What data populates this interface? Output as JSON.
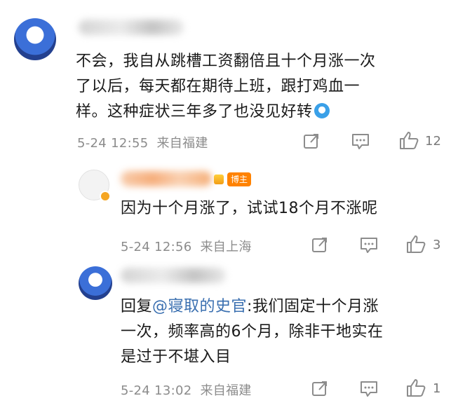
{
  "comments": [
    {
      "username": "",
      "text": "不会，我自从跳槽工资翻倍且十个月涨一次了以后，每天都在期待上班，跟打鸡血一样。这种症状三年多了也没见好转",
      "text_lines": [
        "不会，我自从跳槽工资翻倍且十个月涨一次",
        "了以后，每天都在期待上班，跟打鸡血一",
        "样。这种症状三年多了也没见好转"
      ],
      "emoji": "crying-laughing-emoji",
      "date_time": "5-24 12:55",
      "location": "来自福建",
      "likes": "12"
    },
    {
      "username": "",
      "badge": "博主",
      "text": "因为十个月涨了，试试18个月不涨呢",
      "date_time": "5-24 12:56",
      "location": "来自上海",
      "likes": "3"
    },
    {
      "username": "",
      "reply_prefix": "回复",
      "mention": "@寝取的史官",
      "reply_line1_rest": ":我们固定十个月涨",
      "reply_lines": [
        "一次，频率高的6个月，除非干地实在",
        "是过于不堪入目"
      ],
      "date_time": "5-24 13:02",
      "location": "来自福建",
      "likes": "1"
    }
  ],
  "icons": {
    "share": "share-icon",
    "comment": "comment-icon",
    "like": "thumbs-up-icon"
  },
  "colors": {
    "mention": "#3a6fb0",
    "badge": "#ff8200",
    "meta": "#8c8c8c"
  }
}
